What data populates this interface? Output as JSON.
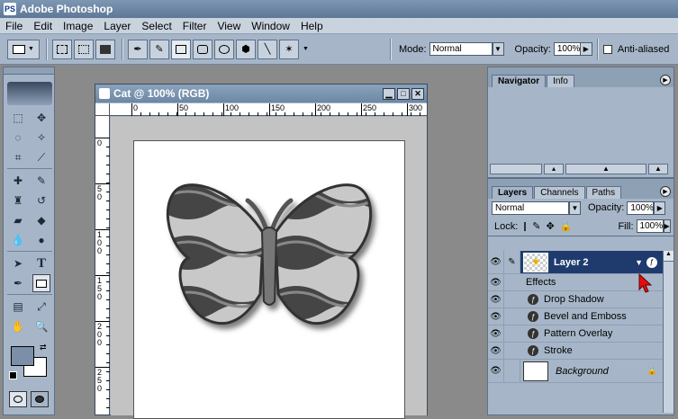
{
  "app": {
    "title": "Adobe Photoshop"
  },
  "menu": [
    "File",
    "Edit",
    "Image",
    "Layer",
    "Select",
    "Filter",
    "View",
    "Window",
    "Help"
  ],
  "options": {
    "mode_label": "Mode:",
    "mode_value": "Normal",
    "opacity_label": "Opacity:",
    "opacity_value": "100%",
    "antialiased_label": "Anti-aliased"
  },
  "document": {
    "title": "Cat @ 100% (RGB)",
    "ruler_h": [
      "0",
      "50",
      "100",
      "150",
      "200",
      "250",
      "300"
    ],
    "ruler_v": [
      "0",
      "5 0",
      "1 0 0",
      "1 5 0",
      "2 0 0",
      "2 5 0"
    ]
  },
  "navigator": {
    "tabs": [
      "Navigator",
      "Info"
    ]
  },
  "layers_panel": {
    "tabs": [
      "Layers",
      "Channels",
      "Paths"
    ],
    "blend_mode": "Normal",
    "opacity_label": "Opacity:",
    "opacity_value": "100%",
    "lock_label": "Lock:",
    "fill_label": "Fill:",
    "fill_value": "100%",
    "layer2_name": "Layer 2",
    "effects_label": "Effects",
    "effects": [
      "Drop Shadow",
      "Bevel and Emboss",
      "Pattern Overlay",
      "Stroke"
    ],
    "background_name": "Background"
  },
  "colors": {
    "accent": "#1f3b6e",
    "panel": "#a6b6c8",
    "selected_layer": "#1f3b6e"
  }
}
